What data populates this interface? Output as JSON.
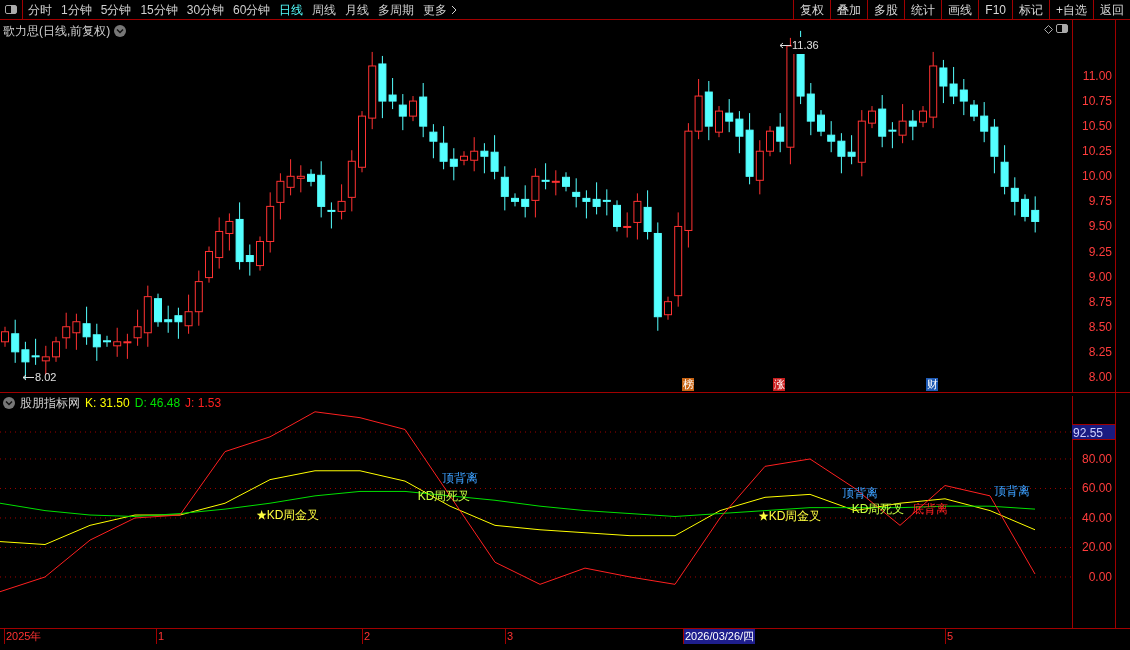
{
  "toolbar": {
    "periods": [
      {
        "label": "分时",
        "selected": false
      },
      {
        "label": "1分钟",
        "selected": false
      },
      {
        "label": "5分钟",
        "selected": false
      },
      {
        "label": "15分钟",
        "selected": false
      },
      {
        "label": "30分钟",
        "selected": false
      },
      {
        "label": "60分钟",
        "selected": false
      },
      {
        "label": "日线",
        "selected": true
      },
      {
        "label": "周线",
        "selected": false
      },
      {
        "label": "月线",
        "selected": false
      },
      {
        "label": "多周期",
        "selected": false
      },
      {
        "label": "更多",
        "selected": false
      }
    ],
    "actions": [
      "复权",
      "叠加",
      "多股",
      "统计",
      "画线",
      "F10",
      "标记",
      "+自选",
      "返回"
    ]
  },
  "main_chart": {
    "title": "歌力思(日线,前复权)",
    "high_label": "11.36",
    "low_label": "8.02",
    "markers": [
      {
        "text": "榜",
        "color": "#c86414"
      },
      {
        "text": "涨",
        "color": "#c81e1e"
      },
      {
        "text": "财",
        "color": "#1e5ab4"
      }
    ],
    "price_ticks": [
      "11.00",
      "10.75",
      "10.50",
      "10.25",
      "10.00",
      "9.75",
      "9.50",
      "9.25",
      "9.00",
      "8.75",
      "8.50",
      "8.25",
      "8.00"
    ]
  },
  "indicator": {
    "name": "股朋指标网",
    "readings": [
      ": 31.50",
      ": 46.48",
      ": 1.53"
    ],
    "current_value": "92.55",
    "chart_data": {
      "type": "line",
      "grid": true,
      "ylim": [
        -34.6,
        122.7
      ],
      "yticks": [
        {
          "value": 80,
          "label": "80.00"
        },
        {
          "value": 60,
          "label": "60.00"
        },
        {
          "value": 40,
          "label": "40.00"
        },
        {
          "value": 20,
          "label": "20.00"
        },
        {
          "value": 0,
          "label": "0.00"
        }
      ],
      "series": [
        {
          "name": "K",
          "color": "#ffff00",
          "values": [
            24,
            22,
            35,
            42,
            42,
            50,
            66,
            72,
            72,
            65,
            48,
            35,
            32,
            30,
            28,
            28,
            45,
            54,
            56,
            45,
            50,
            53,
            45,
            32
          ]
        },
        {
          "name": "D",
          "color": "#00e000",
          "values": [
            50,
            45,
            42,
            41,
            43,
            46,
            50,
            55,
            58,
            58,
            55,
            52,
            48,
            45,
            43,
            41,
            43,
            45,
            47,
            47,
            47,
            48,
            48,
            46
          ]
        },
        {
          "name": "J",
          "color": "#ff2020",
          "values": [
            -10,
            0,
            25,
            40,
            42,
            85,
            95,
            112,
            108,
            100,
            55,
            10,
            -5,
            6,
            0,
            -5,
            40,
            75,
            80,
            60,
            35,
            62,
            55,
            2
          ]
        }
      ]
    },
    "signals": [
      {
        "kind": "golden_cross",
        "text": "KD周金叉"
      },
      {
        "kind": "top_divergence",
        "text": "顶背离"
      },
      {
        "kind": "death_cross",
        "text": "KD周死叉"
      },
      {
        "kind": "golden_cross",
        "text": "KD周金叉"
      },
      {
        "kind": "top_divergence",
        "text": "顶背离"
      },
      {
        "kind": "death_cross",
        "text": "KD周死叉"
      },
      {
        "kind": "bottom_divergence",
        "text": "底背离"
      },
      {
        "kind": "top_divergence",
        "text": "顶背离"
      }
    ]
  },
  "date_axis": [
    {
      "text": "2025年",
      "selected": false
    },
    {
      "text": "1",
      "selected": false
    },
    {
      "text": "2",
      "selected": false
    },
    {
      "text": "3",
      "selected": false
    },
    {
      "text": "2026/03/26/四",
      "selected": true
    },
    {
      "text": "5",
      "selected": false
    }
  ]
}
